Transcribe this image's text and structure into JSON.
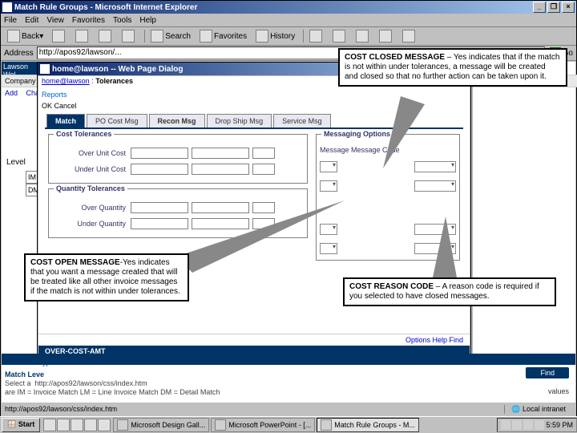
{
  "ie": {
    "title": "Match Rule Groups - Microsoft Internet Explorer",
    "min": "_",
    "max": "❐",
    "close": "×",
    "menu": [
      "File",
      "Edit",
      "View",
      "Favorites",
      "Tools",
      "Help"
    ],
    "tb": {
      "back": "Back",
      "search": "Search",
      "fav": "Favorites",
      "hist": "History"
    },
    "addr_label": "Address",
    "addr_value": "http://apos92/lawson/...",
    "go": "Go",
    "status": "http://apos92/lawson/css/index.htm",
    "zone": "Local intranet"
  },
  "app": {
    "lawson": "Lawson Wel",
    "company": "Company",
    "actions": [
      "Add",
      "Change"
    ],
    "level": "Level",
    "levels": [
      "IM",
      "DM"
    ]
  },
  "dialog": {
    "title": "home@lawson -- Web Page Dialog",
    "crumb_home": "home@lawson",
    "crumb_cur": "Tolerances",
    "reports": "Reports",
    "okcancel": "OK   Cancel",
    "tabs": [
      "Match",
      "PO Cost Msg",
      "Recon Msg",
      "Drop Ship Msg",
      "Service Msg"
    ],
    "grp1": "Cost Tolerances",
    "over_unit": "Over Unit Cost",
    "under_unit": "Under Unit Cost",
    "grp2": "Quantity Tolerances",
    "over_qty": "Over Quantity",
    "under_qty": "Under Quantity",
    "msgopt": "Messaging Options",
    "msgcol": "Message  Message Code",
    "statuslinks": "Options      Help               Find",
    "heading": "OVER-COST-AMT",
    "desc": "Type in an over unit cost amount"
  },
  "callouts": {
    "c1_b": "COST CLOSED MESSAGE",
    "c1": " – Yes indicates that if the match is not within under tolerances, a message will be created and closed so that no further action can be taken upon it.",
    "c2_b": "COST OPEN MESSAGE",
    "c2": "-Yes indicates that you want a message created that will be treated like all other invoice messages if the match is not within under tolerances.",
    "c3_b": "COST REASON CODE",
    "c3": " – A reason code is required if you selected to have closed messages."
  },
  "bottom": {
    "find": "Find",
    "matchlev": "Match Leve",
    "select": "Select a",
    "rest": "are IM = Invoice Match   LM = Line Invoice Match  DM = Detail Match",
    "values": "values"
  },
  "taskbar": {
    "start": "Start",
    "t1": "Microsoft Design Gall...",
    "t2": "Microsoft PowerPoint - [...",
    "t3": "Match Rule Groups - M...",
    "time": "5:59 PM"
  }
}
